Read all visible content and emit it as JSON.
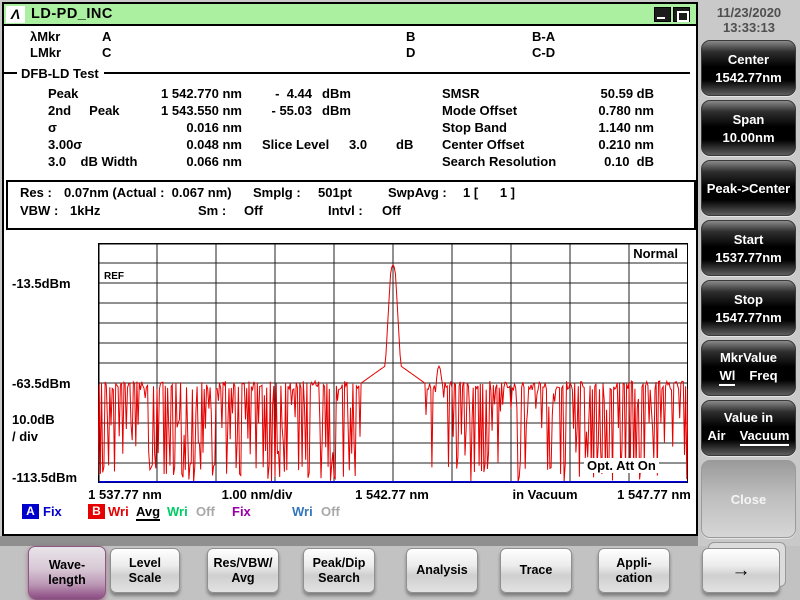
{
  "titlebar": {
    "logo": "Λ",
    "title": "LD-PD_INC"
  },
  "window_controls": {
    "minimize": "minimize",
    "maximize": "maximize"
  },
  "sidebar": {
    "date": "11/23/2020",
    "time": "13:33:13",
    "keys": {
      "center": {
        "line1": "Center",
        "line2": "1542.77nm"
      },
      "span": {
        "line1": "Span",
        "line2": "10.00nm"
      },
      "peak_center": {
        "line1": "Peak->Center"
      },
      "start": {
        "line1": "Start",
        "line2": "1537.77nm"
      },
      "stop": {
        "line1": "Stop",
        "line2": "1547.77nm"
      },
      "mkrvalue": {
        "line1": "MkrValue",
        "opt_on": "Wl",
        "opt_off": "Freq"
      },
      "valuein": {
        "line1": "Value in",
        "opt_off": "Air",
        "opt_on": "Vacuum"
      },
      "close": {
        "line1": "Close"
      }
    }
  },
  "markers": {
    "row1": {
      "label": "λMkr",
      "a": "A",
      "b": "B",
      "diff": "B-A"
    },
    "row2": {
      "label": "LMkr",
      "c": "C",
      "d": "D",
      "diff": "C-D"
    }
  },
  "section_title": "DFB-LD Test",
  "measurements": {
    "left_rows": [
      {
        "label": "Peak",
        "wl": "1 542.770 nm",
        "level": "-  4.44",
        "unit": "dBm"
      },
      {
        "label": "2nd     Peak",
        "wl": "1 543.550 nm",
        "level": "- 55.03",
        "unit": "dBm"
      },
      {
        "label": "σ",
        "wl": "0.016 nm",
        "level": "",
        "unit": ""
      },
      {
        "label": "3.00σ",
        "wl": "0.048 nm",
        "level": "",
        "unit": "",
        "extra_label": "Slice Level",
        "extra_value": "3.0",
        "extra_unit": "dB"
      },
      {
        "label": "3.0    dB Width",
        "wl": "0.066 nm",
        "level": "",
        "unit": ""
      }
    ],
    "right_rows": [
      {
        "label": "SMSR",
        "value": "50.59 dB"
      },
      {
        "label": "Mode Offset",
        "value": "0.780 nm"
      },
      {
        "label": "Stop Band",
        "value": "1.140 nm"
      },
      {
        "label": "Center Offset",
        "value": "0.210 nm"
      },
      {
        "label": "Search Resolution",
        "value": "0.10  dB"
      }
    ]
  },
  "settings": {
    "res_label": "Res :",
    "res_value": "0.07nm (Actual :  0.067 nm)",
    "smplg_label": "Smplg :",
    "smplg_value": "501pt",
    "swpavg_label": "SwpAvg :",
    "swpavg_value": "1 [      1 ]",
    "vbw_label": "VBW :",
    "vbw_value": "1kHz",
    "sm_label": "Sm :",
    "sm_value": "Off",
    "intvl_label": "Intvl :",
    "intvl_value": "Off"
  },
  "chart_data": {
    "type": "line",
    "title": "DFB-LD spectrum, trace B (Wri, Avg)",
    "x_start_nm": 1537.77,
    "x_stop_nm": 1547.77,
    "x_div_nm": 1.0,
    "y_top_dbm": 6.5,
    "y_bottom_dbm": -113.5,
    "y_div_db": 10.0,
    "ref_level_dbm": -13.5,
    "cols": 10,
    "rows": 12,
    "points": 501,
    "x_tick_labels": [
      "1 537.77 nm",
      "1.00 nm/div",
      "1 542.77 nm",
      "in Vacuum",
      "1 547.77 nm"
    ],
    "y_labels": {
      "ref": "-13.5dBm",
      "mid": "-63.5dBm",
      "scale1": "10.0dB",
      "scale2": "/ div",
      "bottom": "-113.5dBm"
    },
    "annotations": {
      "ref": "REF",
      "mode": "Normal",
      "opt_att": "Opt. Att On"
    },
    "main_peak": {
      "wavelength_nm": 1542.77,
      "level_dbm": -4.44
    },
    "second_peak": {
      "wavelength_nm": 1543.55,
      "level_dbm": -55.03
    },
    "noise_floor_dbm": -62.5,
    "noise_spike_min_dbm": -113.5,
    "baseline_trace_dbm": -113.5,
    "series": [
      {
        "name": "B Wri Avg",
        "color": "#e60000"
      },
      {
        "name": "A Fix",
        "color": "#0000dd"
      }
    ]
  },
  "legend": {
    "a_badge": "A",
    "a_mode": "Fix",
    "b_badge": "B",
    "b_mode": "Wri",
    "b_sub": "Avg",
    "c_mode": "Wri",
    "c_state": "Off",
    "d_mode": "Fix",
    "e_mode": "Wri",
    "e_state": "Off"
  },
  "bottom_keys": {
    "wavelength": {
      "line1": "Wave-",
      "line2": "length"
    },
    "level_scale": {
      "line1": "Level",
      "line2": "Scale"
    },
    "res_vbw": {
      "line1": "Res/VBW/",
      "line2": "Avg"
    },
    "peak_dip": {
      "line1": "Peak/Dip",
      "line2": "Search"
    },
    "analysis": {
      "line1": "Analysis"
    },
    "trace": {
      "line1": "Trace"
    },
    "application": {
      "line1": "Appli-",
      "line2": "cation"
    },
    "more": {
      "line1": "→"
    }
  },
  "colors": {
    "titlebar_green": "#aaf0a0",
    "trace_red": "#e60000",
    "trace_blue": "#0000dd",
    "legend_blue": "#0000cc",
    "legend_red": "#e60000",
    "legend_green": "#00cc66",
    "legend_purple": "#9900aa",
    "legend_steel": "#3377bb",
    "legend_gray": "#a8a8a8"
  }
}
